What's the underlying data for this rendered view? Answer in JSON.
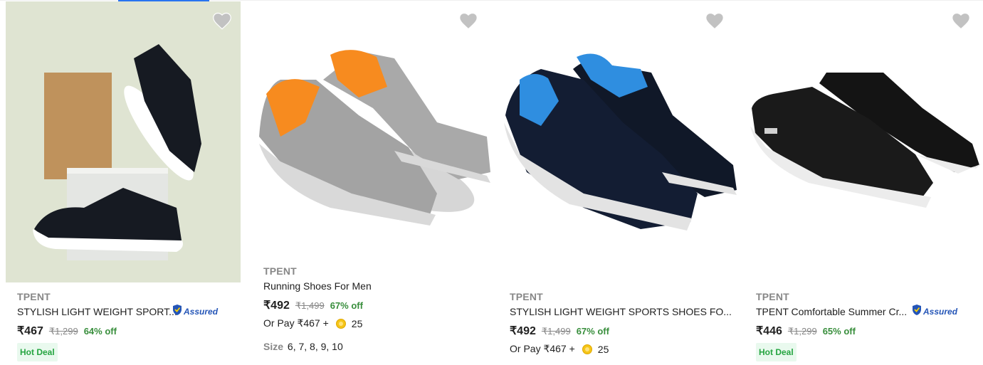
{
  "products": [
    {
      "brand": "TPENT",
      "title": "STYLISH LIGHT WEIGHT SPORT...",
      "assured": "Assured",
      "price": "₹467",
      "mrp": "₹1,299",
      "discount": "64% off",
      "badge": "Hot Deal"
    },
    {
      "brand": "TPENT",
      "title": "Running Shoes For Men",
      "price": "₹492",
      "mrp": "₹1,499",
      "discount": "67% off",
      "or_pay": "Or Pay ₹467 +",
      "coins": "25",
      "size_label": "Size",
      "sizes": "6, 7, 8, 9, 10"
    },
    {
      "brand": "TPENT",
      "title": "STYLISH LIGHT WEIGHT SPORTS SHOES FO...",
      "price": "₹492",
      "mrp": "₹1,499",
      "discount": "67% off",
      "or_pay": "Or Pay ₹467 +",
      "coins": "25"
    },
    {
      "brand": "TPENT",
      "title": "TPENT Comfortable Summer Cr...",
      "assured": "Assured",
      "price": "₹446",
      "mrp": "₹1,299",
      "discount": "65% off",
      "badge": "Hot Deal"
    }
  ],
  "icons": {
    "wishlist": "heart-icon",
    "assured": "shield-check-icon",
    "coin": "supercoin-icon"
  },
  "colors": {
    "accent": "#2874f0",
    "discount": "#388e3c",
    "hot_deal": "#26a541",
    "assured": "#2455b7",
    "muted": "#878787"
  }
}
